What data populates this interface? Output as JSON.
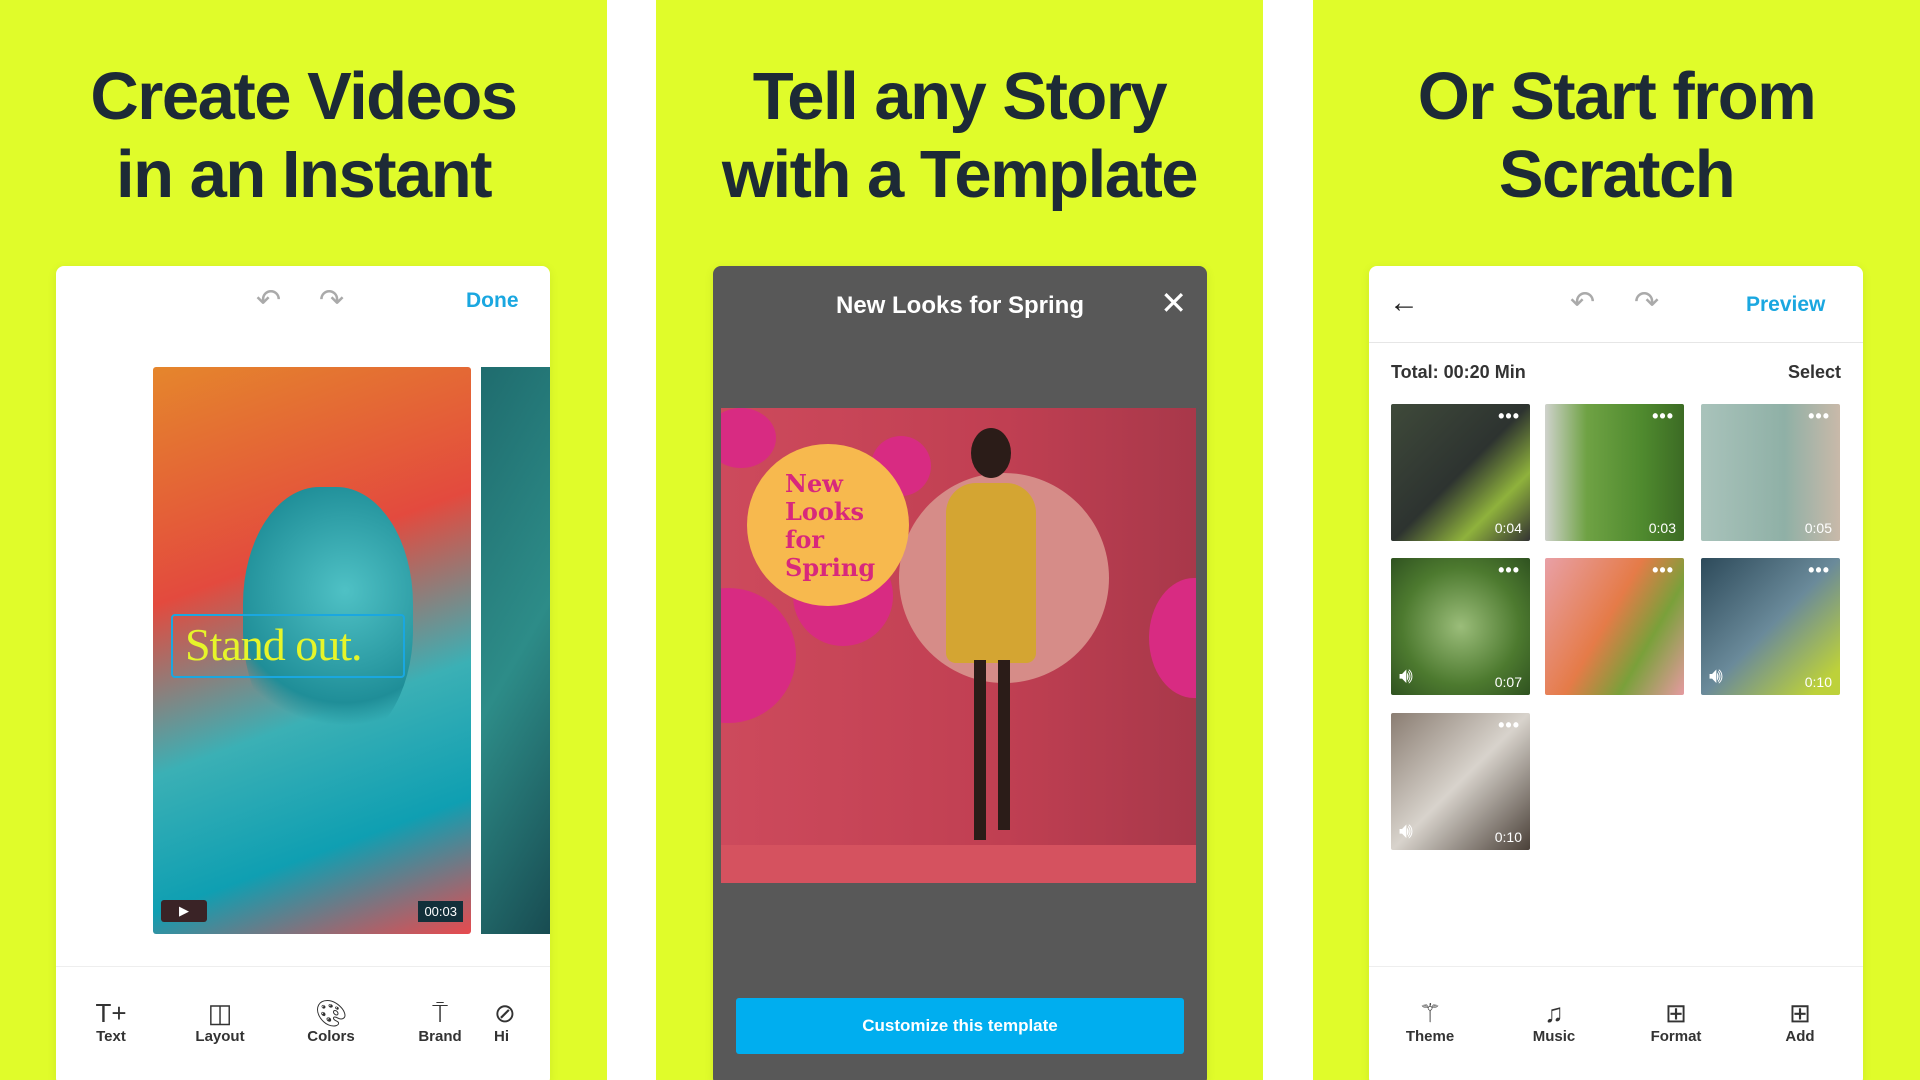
{
  "colors": {
    "background": "#e0fc2a",
    "accent": "#1aa7e0",
    "headline": "#1d2a36",
    "button": "#00aeef"
  },
  "panels": [
    {
      "headline": [
        "Create Videos",
        "in an Instant"
      ],
      "header": {
        "undo_icon": "undo-icon",
        "redo_icon": "redo-icon",
        "done_label": "Done"
      },
      "slide": {
        "caption": "Stand out.",
        "duration": "00:03",
        "play_icon": "play-icon"
      },
      "toolbar": [
        {
          "label": "Text",
          "icon": "text-add-icon"
        },
        {
          "label": "Layout",
          "icon": "layout-icon"
        },
        {
          "label": "Colors",
          "icon": "palette-icon"
        },
        {
          "label": "Brand",
          "icon": "paint-roller-icon"
        },
        {
          "label": "Hi",
          "icon": "hide-icon"
        }
      ]
    },
    {
      "headline": [
        "Tell any Story",
        "with a Template"
      ],
      "modal": {
        "title": "New Looks for Spring",
        "close_icon": "close-icon",
        "preview_text": [
          "New",
          "Looks",
          "for",
          "Spring"
        ],
        "button_label": "Customize this template"
      }
    },
    {
      "headline": [
        "Or Start from",
        "Scratch"
      ],
      "header": {
        "back_icon": "back-arrow-icon",
        "preview_label": "Preview"
      },
      "total": "Total: 00:20 Min",
      "select_label": "Select",
      "clips": [
        {
          "duration": "0:04",
          "sound": false
        },
        {
          "duration": "0:03",
          "sound": false
        },
        {
          "duration": "0:05",
          "sound": false
        },
        {
          "duration": "0:07",
          "sound": true
        },
        {
          "duration": "",
          "sound": false
        },
        {
          "duration": "0:10",
          "sound": true
        },
        {
          "duration": "0:10",
          "sound": true
        }
      ],
      "toolbar": [
        {
          "label": "Theme",
          "icon": "magic-wand-icon"
        },
        {
          "label": "Music",
          "icon": "music-note-icon"
        },
        {
          "label": "Format",
          "icon": "format-icon"
        },
        {
          "label": "Add",
          "icon": "add-box-icon"
        }
      ]
    }
  ]
}
